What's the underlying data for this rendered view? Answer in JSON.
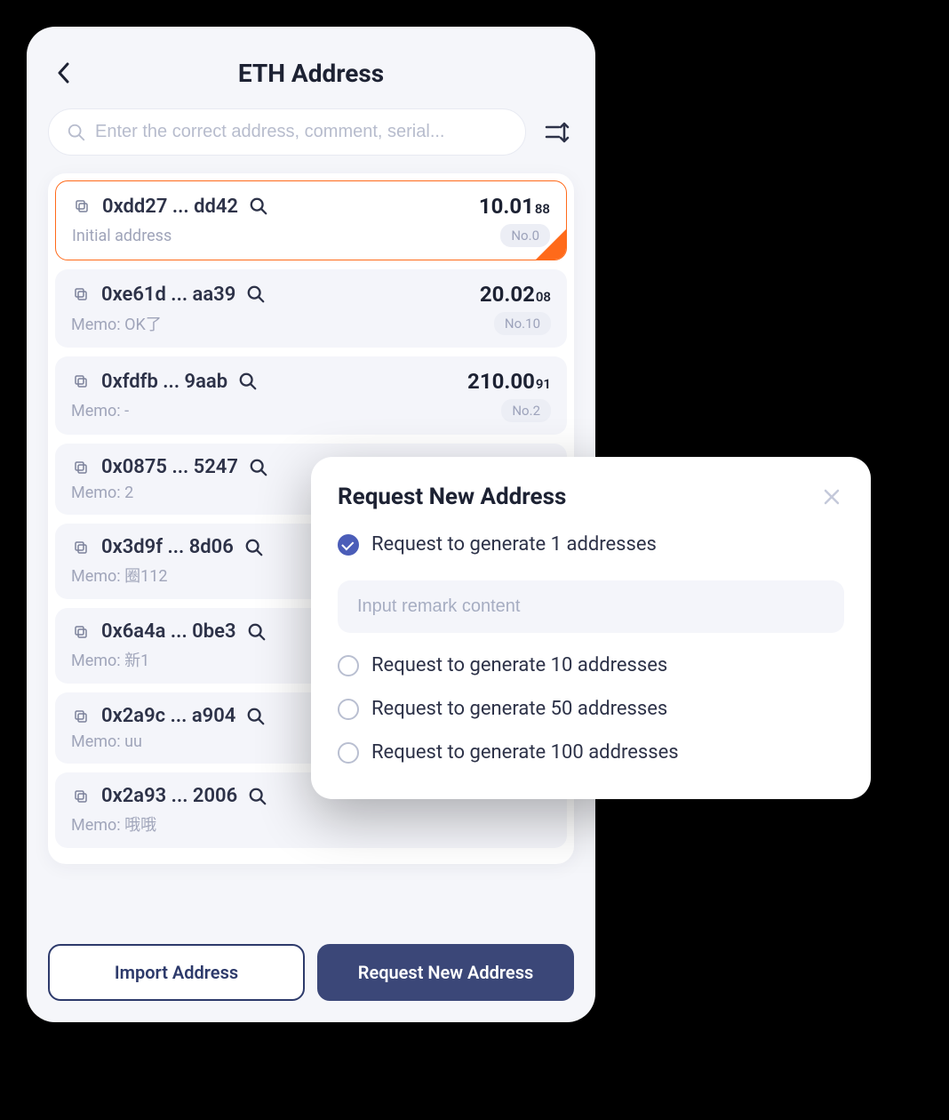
{
  "header": {
    "title": "ETH Address"
  },
  "search": {
    "placeholder": "Enter the correct address, comment, serial..."
  },
  "addresses": [
    {
      "addr": "0xdd27 ... dd42",
      "balance_main": "10.01",
      "balance_sub": "88",
      "memo": "Initial address",
      "badge": "No.0",
      "selected": true
    },
    {
      "addr": "0xe61d ... aa39",
      "balance_main": "20.02",
      "balance_sub": "08",
      "memo": "Memo: OK了",
      "badge": "No.10",
      "selected": false
    },
    {
      "addr": "0xfdfb ... 9aab",
      "balance_main": "210.00",
      "balance_sub": "91",
      "memo": "Memo: -",
      "badge": "No.2",
      "selected": false
    },
    {
      "addr": "0x0875 ... 5247",
      "balance_main": "",
      "balance_sub": "",
      "memo": "Memo: 2",
      "badge": "",
      "selected": false
    },
    {
      "addr": "0x3d9f ... 8d06",
      "balance_main": "",
      "balance_sub": "",
      "memo": "Memo: 圈112",
      "badge": "",
      "selected": false
    },
    {
      "addr": "0x6a4a ... 0be3",
      "balance_main": "",
      "balance_sub": "",
      "memo": "Memo: 新1",
      "badge": "",
      "selected": false
    },
    {
      "addr": "0x2a9c ... a904",
      "balance_main": "",
      "balance_sub": "",
      "memo": "Memo: uu",
      "badge": "",
      "selected": false
    },
    {
      "addr": "0x2a93 ... 2006",
      "balance_main": "",
      "balance_sub": "",
      "memo": "Memo: 哦哦",
      "badge": "",
      "selected": false
    }
  ],
  "buttons": {
    "import": "Import Address",
    "request": "Request New Address"
  },
  "modal": {
    "title": "Request New Address",
    "remark_placeholder": "Input remark content",
    "options": [
      {
        "label": "Request to generate 1 addresses",
        "checked": true
      },
      {
        "label": "Request to generate 10 addresses",
        "checked": false
      },
      {
        "label": "Request to generate 50 addresses",
        "checked": false
      },
      {
        "label": "Request to generate 100 addresses",
        "checked": false
      }
    ]
  }
}
